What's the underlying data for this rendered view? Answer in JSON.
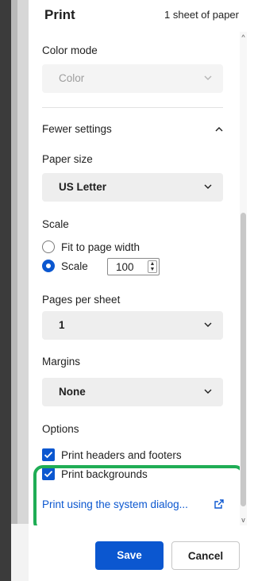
{
  "header": {
    "title": "Print",
    "sheet_count": "1 sheet of paper"
  },
  "color_mode": {
    "label": "Color mode",
    "value": "Color"
  },
  "settings_toggle": {
    "label": "Fewer settings"
  },
  "paper_size": {
    "label": "Paper size",
    "value": "US Letter"
  },
  "scale": {
    "label": "Scale",
    "options": [
      {
        "label": "Fit to page width",
        "selected": false
      },
      {
        "label": "Scale",
        "selected": true
      }
    ],
    "value": "100"
  },
  "pages_per_sheet": {
    "label": "Pages per sheet",
    "value": "1"
  },
  "margins": {
    "label": "Margins",
    "value": "None"
  },
  "options": {
    "label": "Options",
    "items": [
      {
        "label": "Print headers and footers",
        "checked": true
      },
      {
        "label": "Print backgrounds",
        "checked": true
      }
    ]
  },
  "system_dialog": {
    "label": "Print using the system dialog..."
  },
  "footer": {
    "save_label": "Save",
    "cancel_label": "Cancel"
  },
  "colors": {
    "accent": "#0b57d0",
    "highlight": "#1fad55"
  }
}
